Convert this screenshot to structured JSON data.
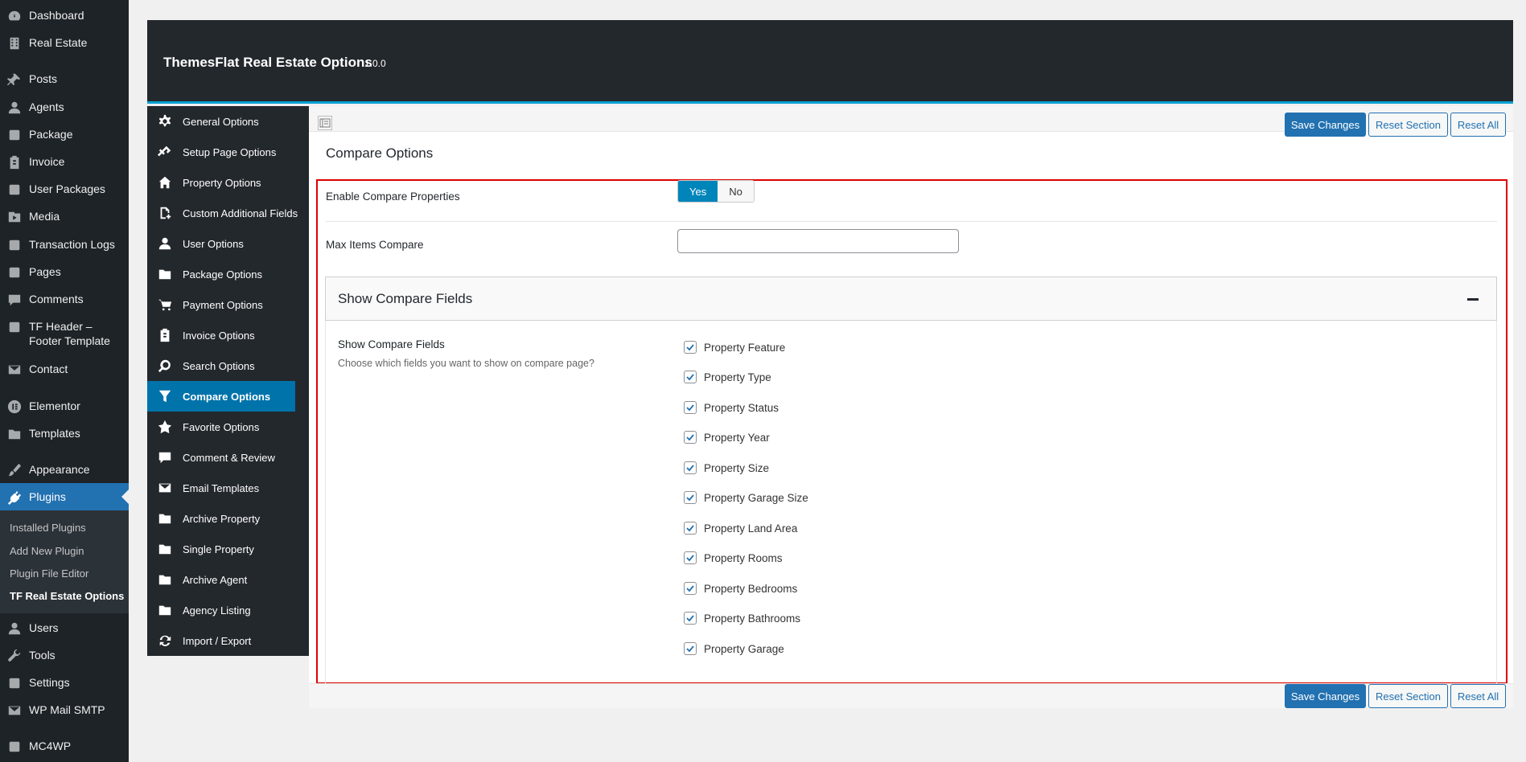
{
  "admin_menu": [
    {
      "label": "Dashboard",
      "icon": "dashboard-icon"
    },
    {
      "label": "Real Estate",
      "icon": "building-icon"
    },
    {
      "label": "Posts",
      "icon": "pin-icon"
    },
    {
      "label": "Agents",
      "icon": "person-icon"
    },
    {
      "label": "Package",
      "icon": "package-icon"
    },
    {
      "label": "Invoice",
      "icon": "invoice-icon"
    },
    {
      "label": "User Packages",
      "icon": "user-packages-icon"
    },
    {
      "label": "Media",
      "icon": "media-icon"
    },
    {
      "label": "Transaction Logs",
      "icon": "transaction-icon"
    },
    {
      "label": "Pages",
      "icon": "pages-icon"
    },
    {
      "label": "Comments",
      "icon": "comment-icon"
    },
    {
      "label": "TF Header –",
      "label2": "Footer Template",
      "icon": "template-icon"
    },
    {
      "label": "Contact",
      "icon": "mail-icon"
    },
    {
      "label": "Elementor",
      "icon": "elementor-icon"
    },
    {
      "label": "Templates",
      "icon": "folder-icon"
    },
    {
      "label": "Appearance",
      "icon": "brush-icon"
    },
    {
      "label": "Plugins",
      "icon": "plug-icon"
    },
    {
      "label": "Users",
      "icon": "person-icon"
    },
    {
      "label": "Tools",
      "icon": "wrench-icon"
    },
    {
      "label": "Settings",
      "icon": "settings-icon"
    },
    {
      "label": "WP Mail SMTP",
      "icon": "smtp-icon"
    },
    {
      "label": "MC4WP",
      "icon": "mc4wp-icon"
    }
  ],
  "plugins_submenu": [
    "Installed Plugins",
    "Add New Plugin",
    "Plugin File Editor",
    "TF Real Estate Options"
  ],
  "header": {
    "title": "ThemesFlat Real Estate Options",
    "version": "1.0.0"
  },
  "sidebar": [
    {
      "label": "General Options",
      "icon": "gear-icon"
    },
    {
      "label": "Setup Page Options",
      "icon": "link-icon"
    },
    {
      "label": "Property Options",
      "icon": "home-icon"
    },
    {
      "label": "Custom Additional Fields",
      "icon": "add-doc-icon"
    },
    {
      "label": "User Options",
      "icon": "user-icon"
    },
    {
      "label": "Package Options",
      "icon": "folder-icon"
    },
    {
      "label": "Payment Options",
      "icon": "cart-icon"
    },
    {
      "label": "Invoice Options",
      "icon": "clipboard-icon"
    },
    {
      "label": "Search Options",
      "icon": "search-icon"
    },
    {
      "label": "Compare Options",
      "icon": "filter-icon"
    },
    {
      "label": "Favorite Options",
      "icon": "star-icon"
    },
    {
      "label": "Comment & Review",
      "icon": "comment-icon"
    },
    {
      "label": "Email Templates",
      "icon": "envelope-icon"
    },
    {
      "label": "Archive Property",
      "icon": "folder-icon"
    },
    {
      "label": "Single Property",
      "icon": "folder-icon"
    },
    {
      "label": "Archive Agent",
      "icon": "folder-icon"
    },
    {
      "label": "Agency Listing",
      "icon": "folder-icon"
    },
    {
      "label": "Import / Export",
      "icon": "refresh-icon"
    }
  ],
  "toolbar": {
    "save": "Save Changes",
    "reset_section": "Reset Section",
    "reset_all": "Reset All"
  },
  "section": {
    "title": "Compare Options"
  },
  "fields": {
    "enable_compare": {
      "label": "Enable Compare Properties",
      "yes": "Yes",
      "no": "No",
      "value": "Yes"
    },
    "max_items": {
      "label": "Max Items Compare",
      "value": ""
    }
  },
  "compare_fields": {
    "accordion_title": "Show Compare Fields",
    "label": "Show Compare Fields",
    "description": "Choose which fields you want to show on compare page?",
    "options": [
      {
        "label": "Property Feature",
        "checked": true
      },
      {
        "label": "Property Type",
        "checked": true
      },
      {
        "label": "Property Status",
        "checked": true
      },
      {
        "label": "Property Year",
        "checked": true
      },
      {
        "label": "Property Size",
        "checked": true
      },
      {
        "label": "Property Garage Size",
        "checked": true
      },
      {
        "label": "Property Land Area",
        "checked": true
      },
      {
        "label": "Property Rooms",
        "checked": true
      },
      {
        "label": "Property Bedrooms",
        "checked": true
      },
      {
        "label": "Property Bathrooms",
        "checked": true
      },
      {
        "label": "Property Garage",
        "checked": true
      }
    ]
  },
  "colors": {
    "accent": "#2271b1",
    "highlight": "#e00000",
    "dark": "#23282d"
  }
}
